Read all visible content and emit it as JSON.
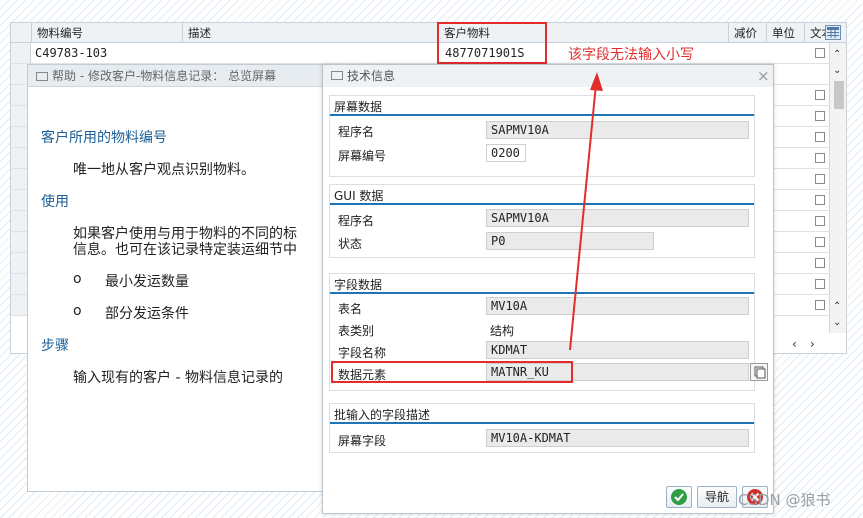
{
  "table": {
    "columns": [
      "物料编号",
      "描述",
      "客户物料",
      "减价",
      "单位",
      "文本"
    ],
    "row1": {
      "material": "C49783-103",
      "customer_material": "4877071901S"
    }
  },
  "help": {
    "title": "帮助 - 修改客户-物料信息记录： 总览屏幕",
    "heading1": "客户所用的物料编号",
    "para1": "唯一地从客户观点识别物料。",
    "heading2": "使用",
    "para2_line1": "如果客户使用与用于物料的不同的标",
    "para2_line2": "信息。也可在该记录特定装运细节中",
    "bullet1": "最小发运数量",
    "bullet2": "部分发运条件",
    "heading3": "步骤",
    "para3": "输入现有的客户 - 物料信息记录的"
  },
  "tech": {
    "title": "技术信息",
    "screen_data": {
      "title": "屏幕数据",
      "program_label": "程序名",
      "program": "SAPMV10A",
      "screen_no_label": "屏幕编号",
      "screen_no": "0200"
    },
    "gui_data": {
      "title": "GUI 数据",
      "program_label": "程序名",
      "program": "SAPMV10A",
      "status_label": "状态",
      "status": "P0"
    },
    "field_data": {
      "title": "字段数据",
      "table_label": "表名",
      "table": "MV10A",
      "table_cat_label": "表类别",
      "table_cat": "结构",
      "field_label": "字段名称",
      "field": "KDMAT",
      "data_element_label": "数据元素",
      "data_element": "MATNR_KU"
    },
    "batch": {
      "title": "批输入的字段描述",
      "screen_field_label": "屏幕字段",
      "screen_field": "MV10A-KDMAT"
    },
    "nav_label": "导航"
  },
  "annotation": {
    "text": "该字段无法输入小写",
    "color": "#e32d2d"
  },
  "watermark": "CSDN @狼书"
}
